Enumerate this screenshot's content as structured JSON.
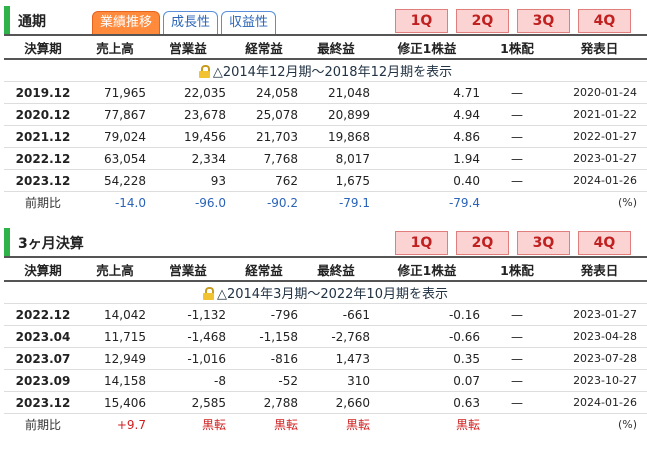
{
  "annual": {
    "title": "通期",
    "tabs": [
      "業績推移",
      "成長性",
      "収益性"
    ],
    "quarter_buttons": [
      "1Q",
      "2Q",
      "3Q",
      "4Q"
    ],
    "headers": [
      "決算期",
      "売上高",
      "営業益",
      "経常益",
      "最終益",
      "修正1株益",
      "1株配",
      "発表日"
    ],
    "note": "△2014年12月期～2018年12月期を表示",
    "rows": [
      {
        "period": "2019.12",
        "sales": "71,965",
        "op": "22,035",
        "ord": "24,058",
        "net": "21,048",
        "eps": "4.71",
        "div": "—",
        "date": "2020-01-24"
      },
      {
        "period": "2020.12",
        "sales": "77,867",
        "op": "23,678",
        "ord": "25,078",
        "net": "20,899",
        "eps": "4.94",
        "div": "—",
        "date": "2021-01-22"
      },
      {
        "period": "2021.12",
        "sales": "79,024",
        "op": "19,456",
        "ord": "21,703",
        "net": "19,868",
        "eps": "4.86",
        "div": "—",
        "date": "2022-01-27"
      },
      {
        "period": "2022.12",
        "sales": "63,054",
        "op": "2,334",
        "ord": "7,768",
        "net": "8,017",
        "eps": "1.94",
        "div": "—",
        "date": "2023-01-27"
      },
      {
        "period": "2023.12",
        "sales": "54,228",
        "op": "93",
        "ord": "762",
        "net": "1,675",
        "eps": "0.40",
        "div": "—",
        "date": "2024-01-26"
      }
    ],
    "comparison": {
      "label": "前期比",
      "sales": "-14.0",
      "op": "-96.0",
      "ord": "-90.2",
      "net": "-79.1",
      "eps": "-79.4",
      "div": "",
      "date": "(%)"
    }
  },
  "quarterly": {
    "title": "3ヶ月決算",
    "quarter_buttons": [
      "1Q",
      "2Q",
      "3Q",
      "4Q"
    ],
    "headers": [
      "決算期",
      "売上高",
      "営業益",
      "経常益",
      "最終益",
      "修正1株益",
      "1株配",
      "発表日"
    ],
    "note": "△2014年3月期～2022年10月期を表示",
    "rows": [
      {
        "period": "2022.12",
        "sales": "14,042",
        "op": "-1,132",
        "ord": "-796",
        "net": "-661",
        "eps": "-0.16",
        "div": "—",
        "date": "2023-01-27"
      },
      {
        "period": "2023.04",
        "sales": "11,715",
        "op": "-1,468",
        "ord": "-1,158",
        "net": "-2,768",
        "eps": "-0.66",
        "div": "—",
        "date": "2023-04-28"
      },
      {
        "period": "2023.07",
        "sales": "12,949",
        "op": "-1,016",
        "ord": "-816",
        "net": "1,473",
        "eps": "0.35",
        "div": "—",
        "date": "2023-07-28"
      },
      {
        "period": "2023.09",
        "sales": "14,158",
        "op": "-8",
        "ord": "-52",
        "net": "310",
        "eps": "0.07",
        "div": "—",
        "date": "2023-10-27"
      },
      {
        "period": "2023.12",
        "sales": "15,406",
        "op": "2,585",
        "ord": "2,788",
        "net": "2,660",
        "eps": "0.63",
        "div": "—",
        "date": "2024-01-26"
      }
    ],
    "comparison": {
      "label": "前期比",
      "sales": "+9.7",
      "op": "黒転",
      "ord": "黒転",
      "net": "黒転",
      "eps": "黒転",
      "div": "",
      "date": "(%)"
    }
  },
  "colors": {
    "accent_green": "#2db34a",
    "tab_active": "#ff8a3c",
    "q_button_bg": "#fbd3d3",
    "negative_blue": "#2a63b8",
    "positive_red": "#d02020"
  }
}
